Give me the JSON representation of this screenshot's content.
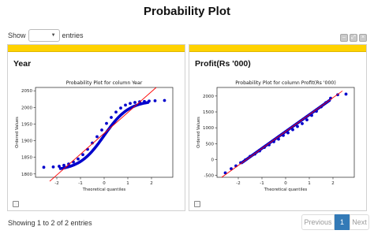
{
  "page": {
    "title": "Probability Plot"
  },
  "controls": {
    "show_label": "Show",
    "entries_label": "entries",
    "length_value": "",
    "tools": [
      {
        "icon": "minimize-icon",
        "glyph": "–"
      },
      {
        "icon": "expand-icon",
        "glyph": "⤢"
      },
      {
        "icon": "close-icon",
        "glyph": "×"
      }
    ]
  },
  "cards": [
    {
      "title": "Year"
    },
    {
      "title": "Profit(Rs '000)"
    }
  ],
  "footer": {
    "info": "Showing 1 to 2 of 2 entries"
  },
  "pagination": {
    "previous": "Previous",
    "current": "1",
    "next": "Next"
  },
  "colors": {
    "accent_bar": "#ffd200",
    "points": "#0000cc",
    "fit_line": "#ff0000",
    "page_active": "#337ab7"
  },
  "chart_data": [
    {
      "type": "scatter",
      "title": "Probability Plot for column Year",
      "xlabel": "Theoretical quantiles",
      "ylabel": "Ordered Values",
      "xlim": [
        -2.9,
        2.9
      ],
      "ylim": [
        1790,
        2060
      ],
      "xticks": [
        -2,
        -1,
        0,
        1,
        2
      ],
      "yticks": [
        1800,
        1850,
        1900,
        1950,
        2000,
        2050
      ],
      "fit_line": {
        "x": [
          -2.3,
          2.2
        ],
        "y": [
          1778,
          2060
        ]
      },
      "series_shape": {
        "kind": "sigmoid",
        "y_low": 1810,
        "y_high": 2021,
        "center": 0.0,
        "slope": 1.9
      },
      "x": [
        -2.55,
        -2.15,
        -1.9,
        -1.7,
        -1.5,
        -1.3,
        -1.1,
        -0.9,
        -0.7,
        -0.5,
        -0.3,
        -0.1,
        0.1,
        0.3,
        0.5,
        0.7,
        0.9,
        1.1,
        1.3,
        1.5,
        1.7,
        1.9,
        2.15,
        2.55
      ],
      "y": [
        1820,
        1821,
        1823,
        1826,
        1830,
        1836,
        1845,
        1858,
        1874,
        1893,
        1912,
        1932,
        1952,
        1970,
        1986,
        1998,
        2007,
        2012,
        2015,
        2017,
        2018,
        2019,
        2020,
        2021
      ]
    },
    {
      "type": "scatter",
      "title": "Probability Plot for column Profit(Rs '000)",
      "xlabel": "Theoretical quantiles",
      "ylabel": "Ordered Values",
      "xlim": [
        -2.9,
        2.9
      ],
      "ylim": [
        -560,
        2270
      ],
      "xticks": [
        -2,
        -1,
        0,
        1,
        2
      ],
      "yticks": [
        -500,
        0,
        500,
        1000,
        1500,
        2000
      ],
      "fit_line": {
        "x": [
          -2.7,
          2.4
        ],
        "y": [
          -560,
          2160
        ]
      },
      "series_shape": {
        "kind": "linear",
        "slope": 530,
        "intercept": 880
      },
      "x": [
        -2.55,
        -2.3,
        -2.1,
        -1.9,
        -1.7,
        -1.5,
        -1.3,
        -1.1,
        -0.9,
        -0.7,
        -0.5,
        -0.3,
        -0.1,
        0.1,
        0.3,
        0.5,
        0.7,
        0.9,
        1.1,
        1.3,
        1.5,
        1.7,
        1.9,
        2.2,
        2.55
      ],
      "y": [
        -420,
        -290,
        -200,
        -100,
        -10,
        100,
        170,
        270,
        380,
        460,
        560,
        640,
        760,
        840,
        940,
        1040,
        1130,
        1250,
        1390,
        1520,
        1660,
        1790,
        1930,
        2040,
        2060
      ]
    }
  ]
}
